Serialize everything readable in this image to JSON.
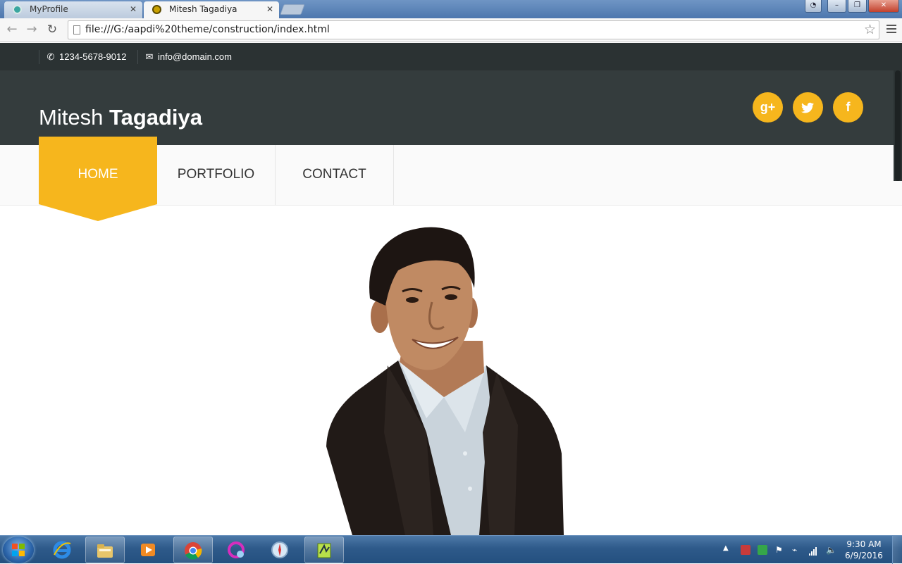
{
  "browser": {
    "tabs": [
      {
        "title": "MyProfile",
        "active": false
      },
      {
        "title": "Mitesh Tagadiya",
        "active": true
      }
    ],
    "tab_close_glyph": "✕",
    "url": "file:///G:/aapdi%20theme/construction/index.html"
  },
  "site": {
    "topbar": {
      "phone": "1234-5678-9012",
      "email": "info@domain.com"
    },
    "brand": {
      "first": "Mitesh",
      "last": "Tagadiya"
    },
    "social": [
      {
        "icon": "google-plus-icon",
        "glyph": "g+"
      },
      {
        "icon": "twitter-icon",
        "glyph": "t"
      },
      {
        "icon": "facebook-icon",
        "glyph": "f"
      }
    ],
    "nav": [
      {
        "label": "HOME",
        "active": true
      },
      {
        "label": "PORTFOLIO",
        "active": false
      },
      {
        "label": "CONTACT",
        "active": false
      }
    ],
    "accent_color": "#f6b61d",
    "header_color": "#343c3d",
    "topbar_color": "#2b3233"
  },
  "taskbar": {
    "time": "9:30 AM",
    "date": "6/9/2016",
    "apps": [
      "start-orb",
      "internet-explorer",
      "windows-explorer",
      "media-player",
      "chrome",
      "uc-browser",
      "safari",
      "notepad-app"
    ]
  }
}
